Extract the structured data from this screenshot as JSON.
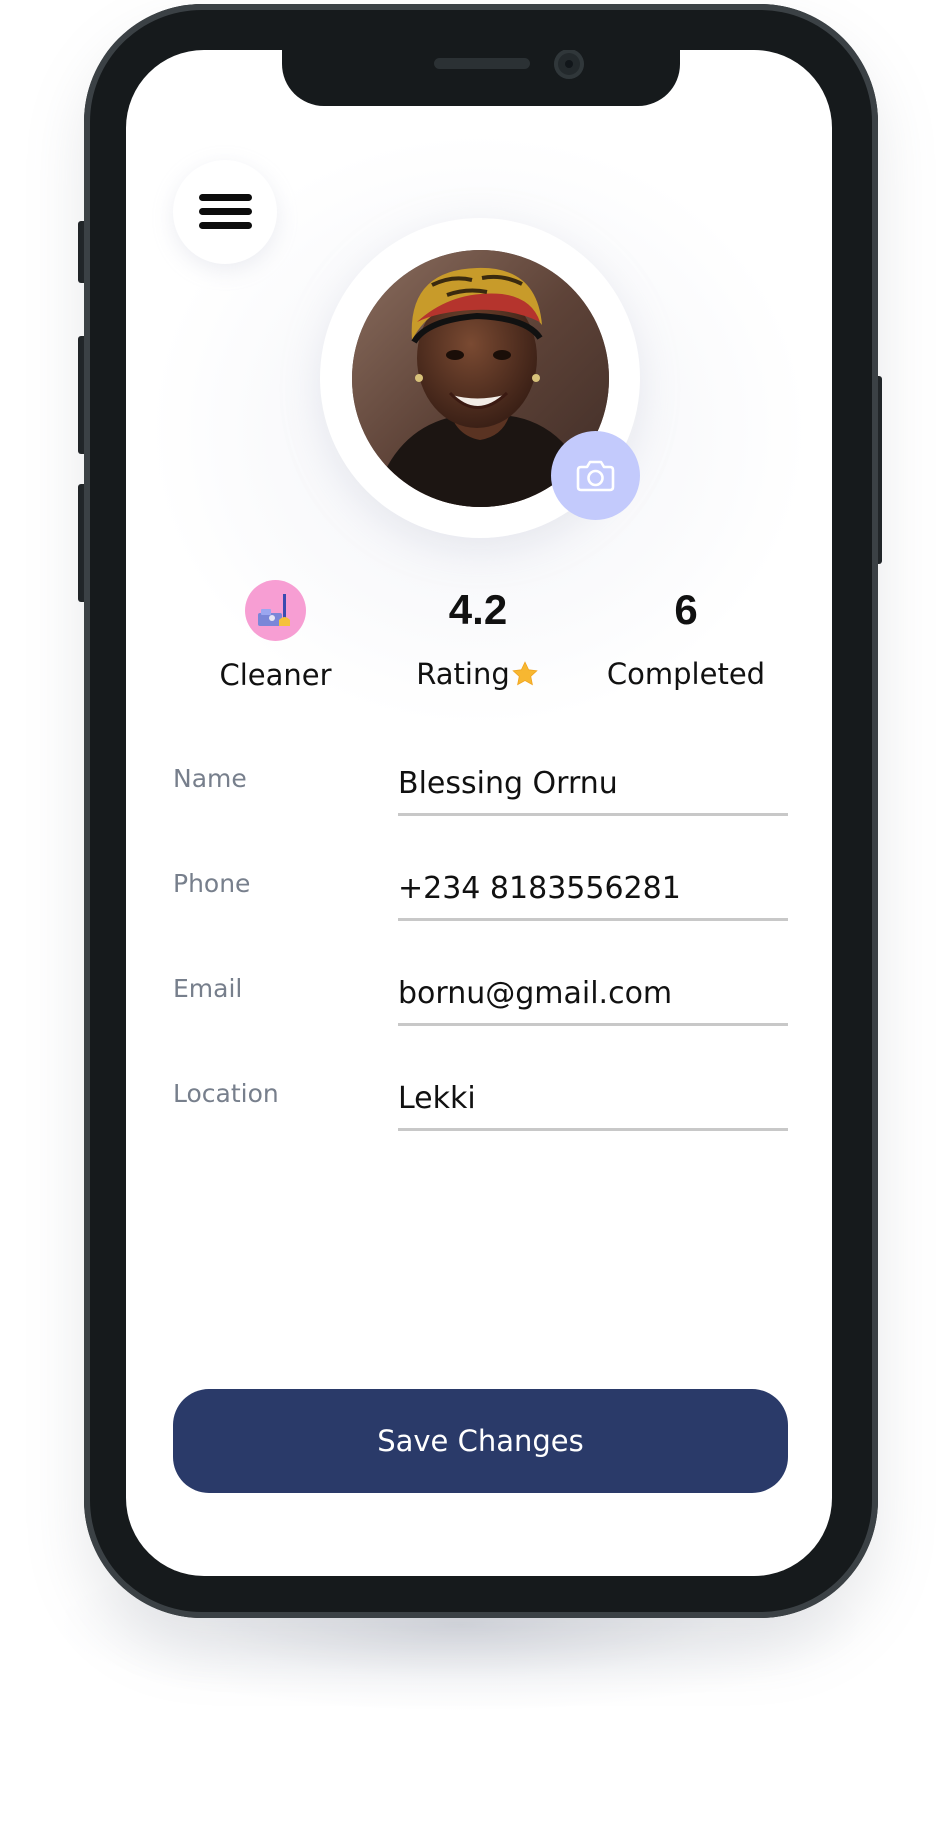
{
  "header": {
    "menu_icon": "hamburger-menu-icon"
  },
  "profile": {
    "photo_alt": "Profile photo of a smiling woman wearing a yellow and red headwrap",
    "camera_icon": "camera-icon"
  },
  "stats": {
    "role_label": "Cleaner",
    "role_icon": "cleaning-supplies-icon",
    "rating_value": "4.2",
    "rating_label": "Rating",
    "rating_icon": "star-icon",
    "completed_value": "6",
    "completed_label": "Completed"
  },
  "form": {
    "fields": [
      {
        "label": "Name",
        "value": "Blessing Orrnu"
      },
      {
        "label": "Phone",
        "value": "+234 8183556281"
      },
      {
        "label": "Email",
        "value": "bornu@gmail.com"
      },
      {
        "label": "Location",
        "value": "Lekki"
      }
    ]
  },
  "actions": {
    "save_label": "Save Changes"
  },
  "colors": {
    "primary_button": "#2a3a69",
    "camera_button": "#c3cafc",
    "role_badge": "#f79ed3",
    "star": "#f7b731",
    "phone_frame": "#161a1c"
  }
}
